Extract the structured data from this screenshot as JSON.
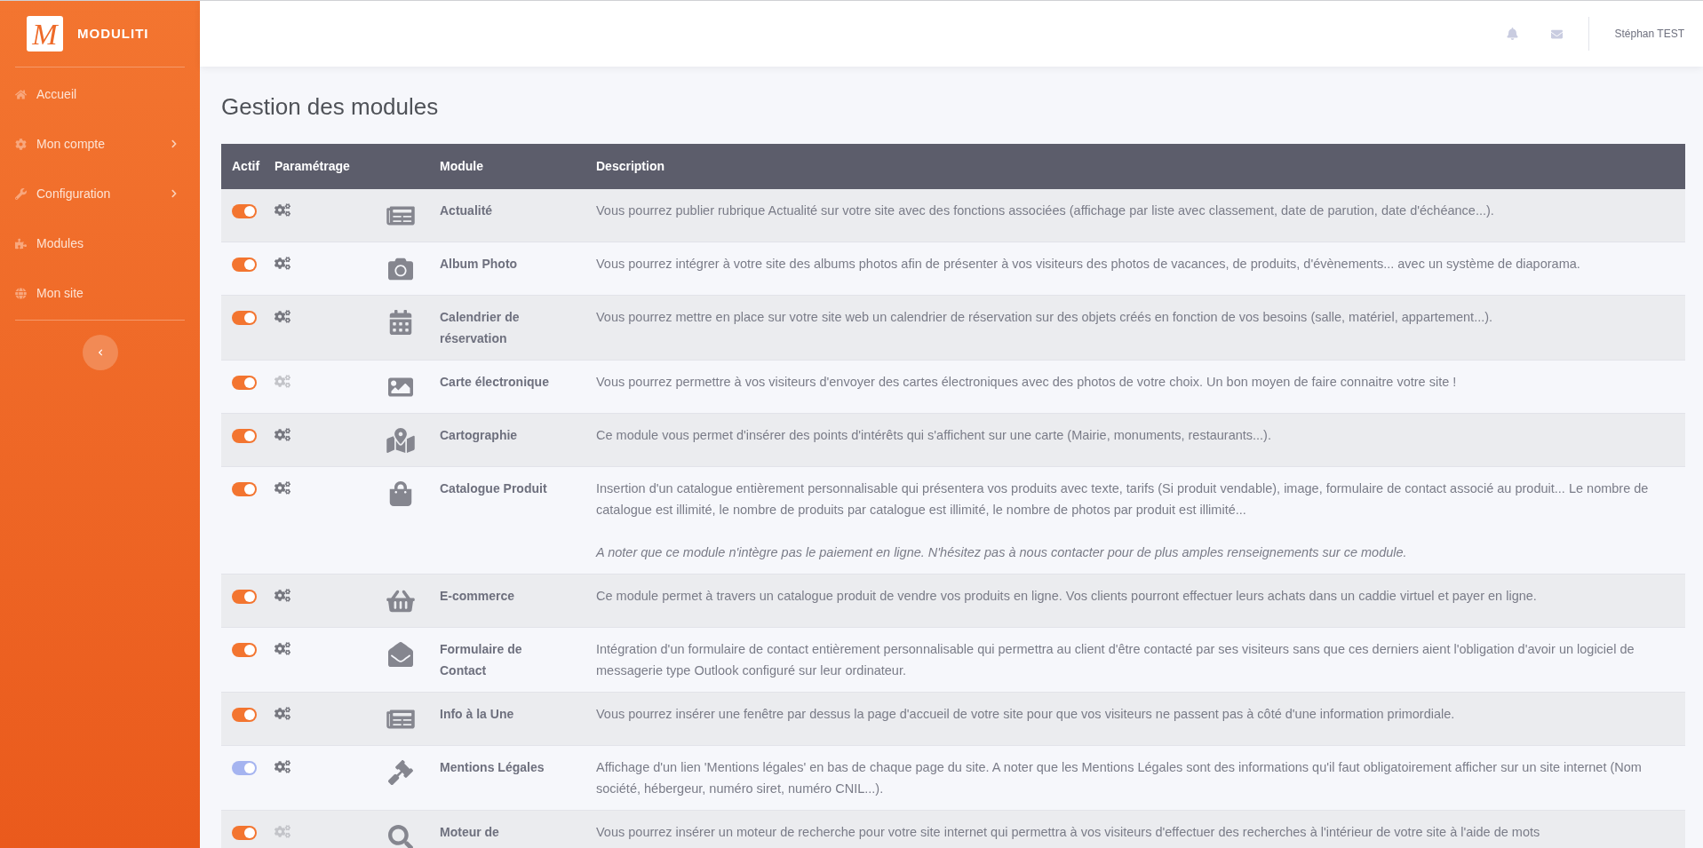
{
  "brand": {
    "logo_letter": "M",
    "name": "MODULITI"
  },
  "sidebar": {
    "items": [
      {
        "label": "Accueil",
        "has_submenu": false,
        "selected": false
      },
      {
        "label": "Mon compte",
        "has_submenu": true,
        "selected": false
      },
      {
        "label": "Configuration",
        "has_submenu": true,
        "selected": false
      },
      {
        "label": "Modules",
        "has_submenu": false,
        "selected": false
      },
      {
        "label": "Mon site",
        "has_submenu": false,
        "selected": false
      }
    ]
  },
  "header": {
    "user": "Stéphan TEST"
  },
  "page": {
    "title": "Gestion des modules"
  },
  "table": {
    "columns": [
      "Actif",
      "Paramétrage",
      "Module",
      "Description"
    ],
    "rows": [
      {
        "on": true,
        "color": "#f37530",
        "settings_enabled": true,
        "module": "Actualité",
        "description": "Vous pourrez publier rubrique Actualité sur votre site avec des fonctions associées (affichage par liste avec classement, date de parution, date d'échéance...)."
      },
      {
        "on": true,
        "color": "#f37530",
        "settings_enabled": true,
        "module": "Album Photo",
        "description": "Vous pourrez intégrer à votre site des albums photos afin de présenter à vos visiteurs des photos de vacances, de produits, d'évènements... avec un système de diaporama."
      },
      {
        "on": true,
        "color": "#f37530",
        "settings_enabled": true,
        "module": "Calendrier de réservation",
        "description": "Vous pourrez mettre en place sur votre site web un calendrier de réservation sur des objets créés en fonction de vos besoins (salle, matériel, appartement...)."
      },
      {
        "on": true,
        "color": "#f37530",
        "settings_enabled": false,
        "module": "Carte électronique",
        "description": "Vous pourrez permettre à vos visiteurs d'envoyer des cartes électroniques avec des photos de votre choix. Un bon moyen de faire connaitre votre site !"
      },
      {
        "on": true,
        "color": "#f37530",
        "settings_enabled": true,
        "module": "Cartographie",
        "description": "Ce module vous permet d'insérer des points d'intérêts qui s'affichent sur une carte (Mairie, monuments, restaurants...)."
      },
      {
        "on": true,
        "color": "#f37530",
        "settings_enabled": true,
        "module": "Catalogue Produit",
        "description": "Insertion d'un catalogue entièrement personnalisable qui présentera vos produits avec texte, tarifs (Si produit vendable), image, formulaire de contact associé au produit... Le nombre de catalogue est illimité, le nombre de produits par catalogue est illimité, le nombre de photos par produit est illimité...",
        "note": "A noter que ce module n'intègre pas le paiement en ligne. N'hésitez pas à nous contacter pour de plus amples renseignements sur ce module."
      },
      {
        "on": true,
        "color": "#f37530",
        "settings_enabled": true,
        "module": "E-commerce",
        "description": "Ce module permet à travers un catalogue produit de vendre vos produits en ligne. Vos clients pourront effectuer leurs achats dans un caddie virtuel et payer en ligne."
      },
      {
        "on": true,
        "color": "#f37530",
        "settings_enabled": true,
        "module": "Formulaire de Contact",
        "description": "Intégration d'un formulaire de contact entièrement personnalisable qui permettra au client d'être contacté par ses visiteurs sans que ces derniers aient l'obligation d'avoir un logiciel de messagerie type Outlook configuré sur leur ordinateur."
      },
      {
        "on": true,
        "color": "#f37530",
        "settings_enabled": true,
        "module": "Info à la Une",
        "description": "Vous pourrez insérer une fenêtre par dessus la page d'accueil de votre site pour que vos visiteurs ne passent pas à côté d'une information primordiale."
      },
      {
        "on": true,
        "color": "#a5b4f0",
        "settings_enabled": true,
        "module": "Mentions Légales",
        "description": "Affichage d'un lien 'Mentions légales' en bas de chaque page du site. A noter que les Mentions Légales sont des informations qu'il faut obligatoirement afficher sur un site internet (Nom société, hébergeur, numéro siret, numéro CNIL...)."
      },
      {
        "on": true,
        "color": "#f37530",
        "settings_enabled": false,
        "module": "Moteur de",
        "description": "Vous pourrez insérer un moteur de recherche pour votre site internet qui permettra à vos visiteurs d'effectuer des recherches à l'intérieur de votre site à l'aide de mots"
      }
    ]
  }
}
